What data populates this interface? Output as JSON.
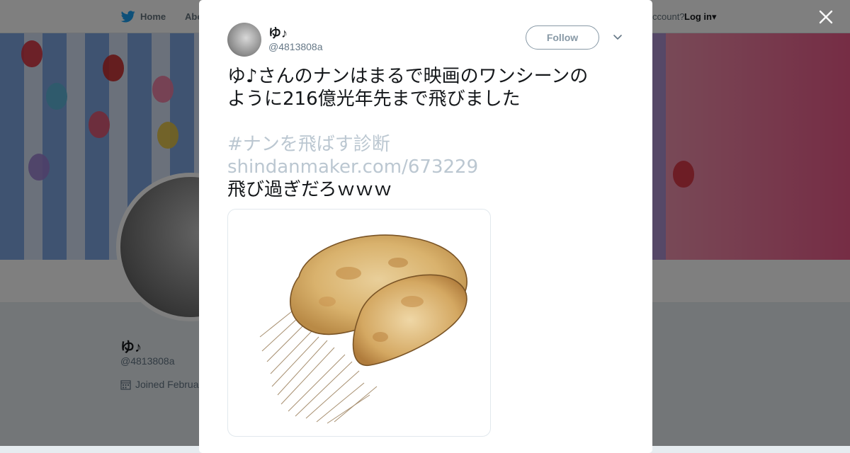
{
  "topbar": {
    "home_label": "Home",
    "about_label": "Abo",
    "account_prompt": "ccount?",
    "login_label": "Log in"
  },
  "profile": {
    "name": "ゆ♪",
    "handle": "@4813808a",
    "joined": "Joined Februa"
  },
  "tweet": {
    "author_name": "ゆ♪",
    "author_handle": "@4813808a",
    "follow_label": "Follow",
    "text_line1": "ゆ♪さんのナンはまるで映画のワンシーンの",
    "text_line2": "ように216億光年先まで飛びました",
    "hashtag": "#ナンを飛ばす診断",
    "link": "shindanmaker.com/673229",
    "text_line3": "飛び過ぎだろｗｗｗ",
    "image_alt": "naan-flying-illustration"
  },
  "icons": {
    "bird": "twitter-bird-icon",
    "close": "close-icon",
    "caret": "chevron-down-icon",
    "calendar": "calendar-icon"
  },
  "colors": {
    "brand": "#1da1f2",
    "link_faded": "#bbc7d1",
    "overlay": "rgba(0,0,0,0.5)"
  }
}
